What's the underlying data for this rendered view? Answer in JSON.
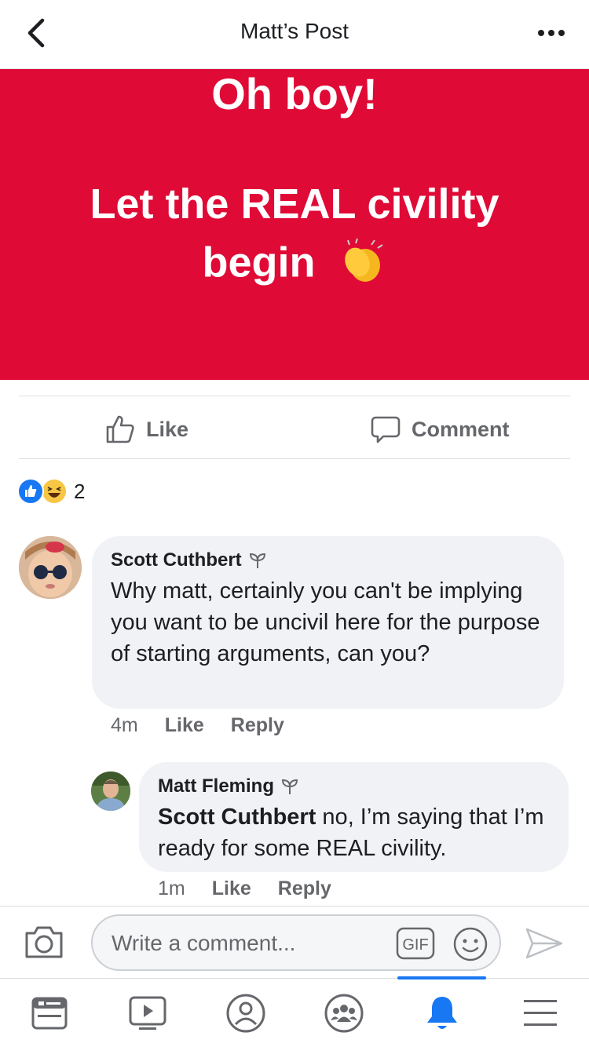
{
  "header": {
    "title": "Matt’s Post"
  },
  "post": {
    "line1": "Oh boy!",
    "line2": "Let the REAL civility",
    "line3": "begin",
    "bg_color": "#e00a36"
  },
  "actions": {
    "like_label": "Like",
    "comment_label": "Comment"
  },
  "reactions": {
    "icons": [
      "like-icon",
      "haha-icon"
    ],
    "count": "2"
  },
  "comments": [
    {
      "author": "Scott Cuthbert",
      "text": "Why matt, certainly you can't be implying you want to be uncivil here for the purpose of starting arguments, can you?",
      "time": "4m",
      "like_label": "Like",
      "reply_label": "Reply"
    },
    {
      "author": "Matt Fleming",
      "mention": "Scott Cuthbert",
      "text": " no, I’m saying that I’m ready for some REAL civility.",
      "time": "1m",
      "like_label": "Like",
      "reply_label": "Reply"
    }
  ],
  "composer": {
    "placeholder": "Write a comment...",
    "gif_label": "GIF"
  },
  "tabs": [
    {
      "name": "news-feed-icon",
      "active": false
    },
    {
      "name": "watch-icon",
      "active": false
    },
    {
      "name": "profile-icon",
      "active": false
    },
    {
      "name": "groups-icon",
      "active": false
    },
    {
      "name": "notifications-icon",
      "active": true
    },
    {
      "name": "menu-icon",
      "active": false
    }
  ],
  "colors": {
    "accent": "#1877f2",
    "text": "#1c1e21",
    "secondary_text": "#65676b",
    "bubble": "#f0f2f5"
  }
}
